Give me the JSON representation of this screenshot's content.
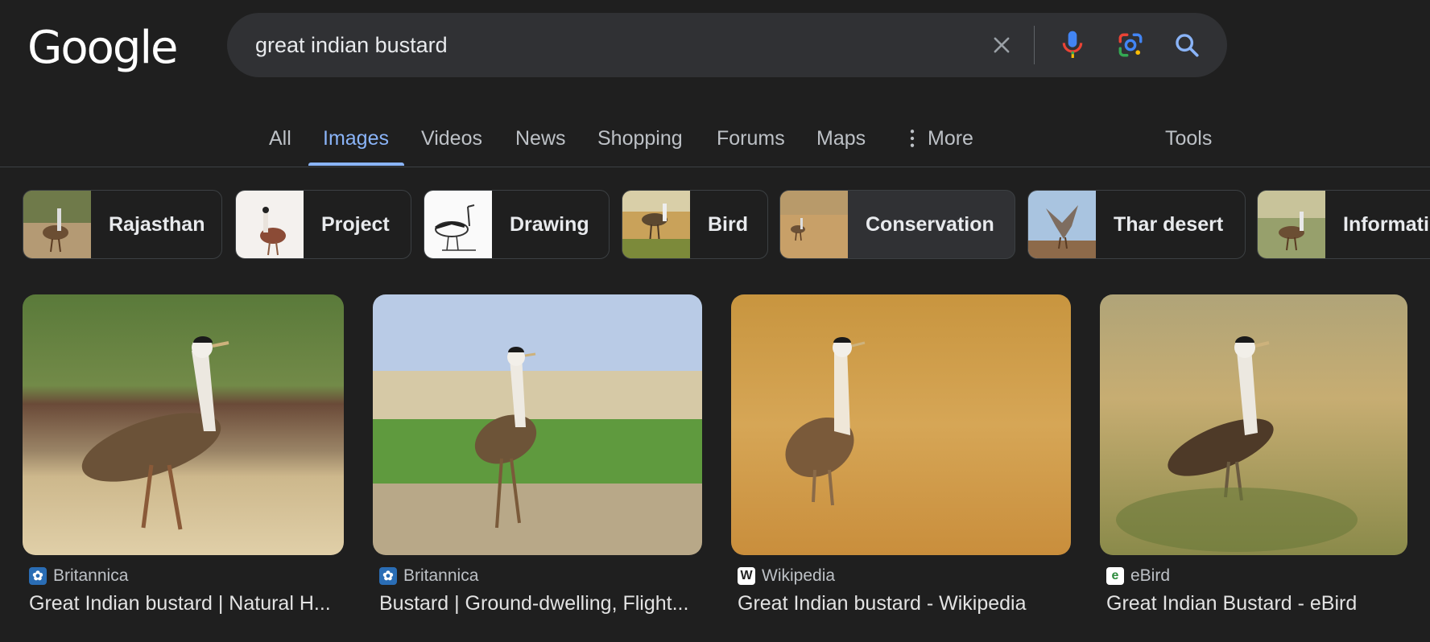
{
  "logo": "Google",
  "search": {
    "query": "great indian bustard"
  },
  "tabs": [
    {
      "label": "All"
    },
    {
      "label": "Images"
    },
    {
      "label": "Videos"
    },
    {
      "label": "News"
    },
    {
      "label": "Shopping"
    },
    {
      "label": "Forums"
    },
    {
      "label": "Maps"
    },
    {
      "label": "More"
    }
  ],
  "tools_label": "Tools",
  "chips": [
    {
      "label": "Rajasthan"
    },
    {
      "label": "Project"
    },
    {
      "label": "Drawing"
    },
    {
      "label": "Bird"
    },
    {
      "label": "Conservation",
      "selected": true
    },
    {
      "label": "Thar desert"
    },
    {
      "label": "Information"
    }
  ],
  "results": [
    {
      "source": "Britannica",
      "title": "Great Indian bustard | Natural H..."
    },
    {
      "source": "Britannica",
      "title": "Bustard | Ground-dwelling, Flight..."
    },
    {
      "source": "Wikipedia",
      "title": "Great Indian bustard - Wikipedia"
    },
    {
      "source": "eBird",
      "title": "Great Indian Bustard - eBird"
    }
  ],
  "colors": {
    "background": "#1f1f1f",
    "accent": "#8ab4f8",
    "search_box": "#303134"
  }
}
